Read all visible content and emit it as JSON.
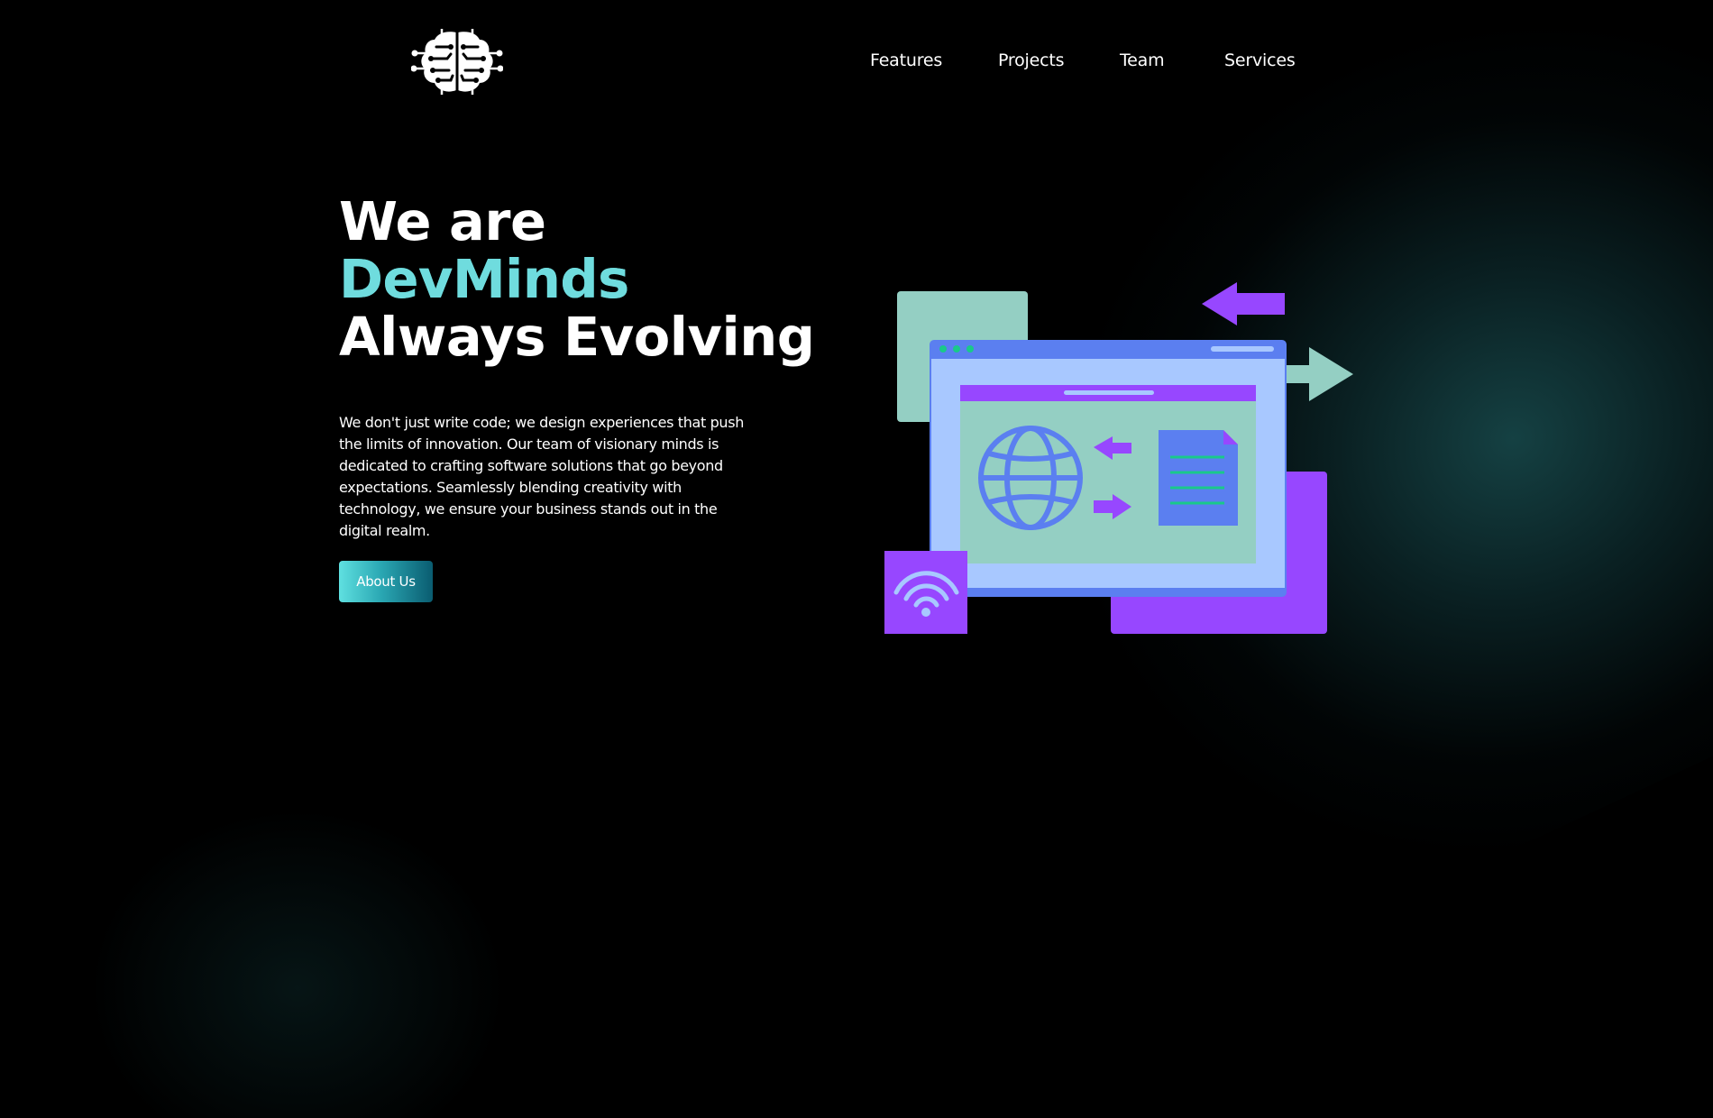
{
  "nav": {
    "logo_alt": "DevMinds logo",
    "links": [
      {
        "label": "Features"
      },
      {
        "label": "Projects"
      },
      {
        "label": "Team"
      },
      {
        "label": "Services"
      }
    ]
  },
  "hero": {
    "title_line1": "We are",
    "title_line2": "DevMinds",
    "title_line3": "Always Evolving",
    "description": "We don't just write code; we design experiences that push the limits of innovation. Our team of visionary minds is dedicated to crafting software solutions that go beyond expectations. Seamlessly blending creativity with technology, we ensure your business stands out in the digital realm.",
    "button_label": "About Us"
  },
  "colors": {
    "background": "#000000",
    "accent_teal": "#6fdcde",
    "purple": "#9747ff",
    "mint": "#94cfc3",
    "blue": "#5b7ff0",
    "light_blue": "#a8c8ff",
    "green_lines": "#19c98a"
  },
  "icons": {
    "logo": "brain-circuit-icon",
    "illustration": "web-browser-network-illustration"
  }
}
